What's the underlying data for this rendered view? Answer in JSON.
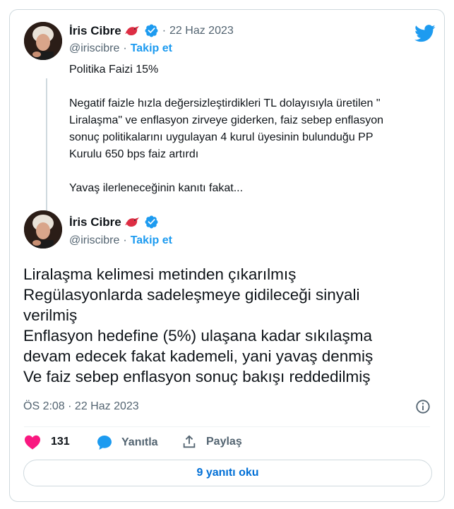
{
  "tweet_parent": {
    "author_name": "İris Cibre",
    "handle": "@iriscibre",
    "separator": "·",
    "follow_label": "Takip et",
    "date": "22 Haz 2023",
    "dot": "·",
    "text_lines": [
      "Politika Faizi 15%",
      "",
      "Negatif faizle hızla değersizleştirdikleri TL dolayısıyla üretilen \"",
      "Liralaşma\" ve enflasyon zirveye giderken, faiz sebep enflasyon",
      "sonuç politikalarını uygulayan 4 kurul üyesinin bulunduğu PP",
      "Kurulu 650 bps faiz artırdı",
      "",
      "Yavaş ilerleneceğinin kanıtı fakat..."
    ]
  },
  "tweet_main": {
    "author_name": "İris Cibre",
    "handle": "@iriscibre",
    "separator": "·",
    "follow_label": "Takip et",
    "text_lines": [
      "Liralaşma kelimesi metinden çıkarılmış",
      "Regülasyonlarda sadeleşmeye gidileceği sinyali",
      "verilmiş",
      "Enflasyon hedefine (5%) ulaşana kadar sıkılaşma",
      "devam edecek fakat kademeli, yani yavaş denmiş",
      "Ve faiz sebep enflasyon sonuç bakışı reddedilmiş"
    ],
    "timestamp": "ÖS 2:08 · 22 Haz 2023"
  },
  "actions": {
    "like_count": "131",
    "reply_label": "Yanıtla",
    "share_label": "Paylaş"
  },
  "read_replies_label": "9 yanıtı oku",
  "colors": {
    "brand_blue": "#1d9bf0",
    "heart": "#f91880",
    "text": "#0f1419",
    "muted": "#536471"
  },
  "icons": [
    "twitter-bird-icon",
    "verified-badge-icon",
    "bird-emoji-icon",
    "info-icon",
    "heart-icon",
    "reply-bubble-icon",
    "share-icon"
  ]
}
